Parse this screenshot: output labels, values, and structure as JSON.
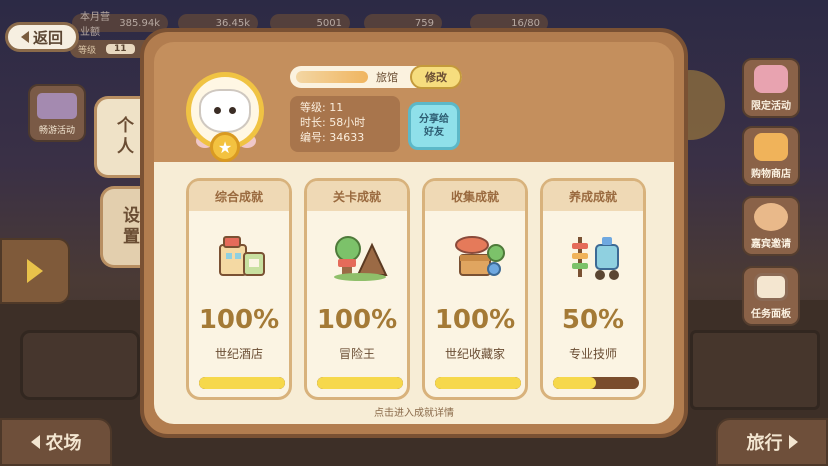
{
  "top": {
    "back_label": "返回",
    "resources": [
      {
        "label": "本月营业额",
        "value": "385.94k"
      },
      {
        "label": "",
        "value": "36.45k"
      },
      {
        "label": "",
        "value": "5001"
      },
      {
        "label": "",
        "value": "759"
      },
      {
        "label": "",
        "value": "16/80"
      }
    ],
    "level_pill_label": "等级",
    "level_pill_value": "11"
  },
  "left": {
    "travel_activity": "畅游活动",
    "farm": "农场"
  },
  "right": {
    "items": [
      {
        "label": "限定活动",
        "icon": "balloon-icon",
        "color": "#e8a3b0"
      },
      {
        "label": "购物商店",
        "icon": "shop-icon",
        "color": "#f0b35a"
      },
      {
        "label": "嘉宾邀请",
        "icon": "hamster-icon",
        "color": "#e9b98a"
      },
      {
        "label": "任务面板",
        "icon": "task-board-icon",
        "color": "#8b6a55"
      }
    ],
    "travel": "旅行"
  },
  "tabs": {
    "personal": "个人",
    "settings": "设置"
  },
  "profile": {
    "hotel_label": "旅馆",
    "edit_label": "修改",
    "level_line": "等级: 11",
    "duration_line": "时长: 58小时",
    "id_line": "编号: 34633",
    "share_label": "分享给好友"
  },
  "achievements": [
    {
      "category": "综合成就",
      "percent": "100%",
      "title": "世纪酒店",
      "progress": 1.0,
      "icon": "hotel-icon"
    },
    {
      "category": "关卡成就",
      "percent": "100%",
      "title": "冒险王",
      "progress": 1.0,
      "icon": "adventure-icon"
    },
    {
      "category": "收集成就",
      "percent": "100%",
      "title": "世纪收藏家",
      "progress": 1.0,
      "icon": "treasure-chest-icon"
    },
    {
      "category": "养成成就",
      "percent": "50%",
      "title": "专业技师",
      "progress": 0.5,
      "icon": "tools-icon"
    }
  ],
  "hint": "点击进入成就详情",
  "colors": {
    "panel": "#b27d4f",
    "card_bg": "#fbf4e3",
    "bar_fill": "#f6d84b",
    "bar_track": "#7a4d2c",
    "percent_text": "#a47a36"
  }
}
